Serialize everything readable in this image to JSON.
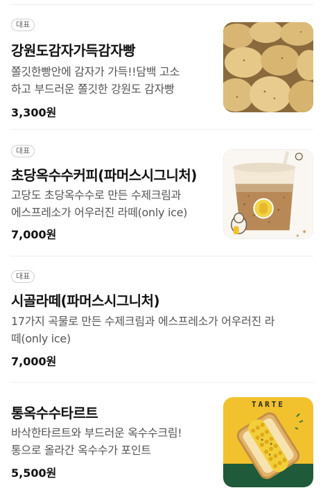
{
  "menu": {
    "items": [
      {
        "badge": "대표",
        "name": "강원도감자가득감자빵",
        "desc_lines": [
          "쫄깃한빵안에 감자가 가득!!담백 고소",
          "하고 부드러운 쫄깃한 강원도 감자빵"
        ],
        "price": "3,300원",
        "image": "potato-bread-photo"
      },
      {
        "badge": "대표",
        "name": "초당옥수수커피(파머스시그니처)",
        "desc_lines": [
          "고당도 초당옥수수로 만든 수제크림과",
          "에스프레소가 어우러진 라떼(only ice)"
        ],
        "price": "7,000원",
        "image": "corn-coffee-photo"
      },
      {
        "badge": "대표",
        "name": "시골라떼(파머스시그니처)",
        "desc_lines": [
          "17가지 곡물로 만든 수제크림과 에스프레소가 어우러진 라",
          "떼(only ice)"
        ],
        "price": "7,000원",
        "image": null
      },
      {
        "badge": null,
        "name": "통옥수수타르트",
        "desc_lines": [
          "바삭한타르트와 부드러운 옥수수크림!",
          "통으로 올라간 옥수수가 포인트"
        ],
        "price": "5,500원",
        "image": "corn-tart-photo",
        "image_text": "TARTE"
      }
    ]
  },
  "colors": {
    "corn_yellow": "#f2c12e",
    "tart_green": "#1f5a3a"
  }
}
